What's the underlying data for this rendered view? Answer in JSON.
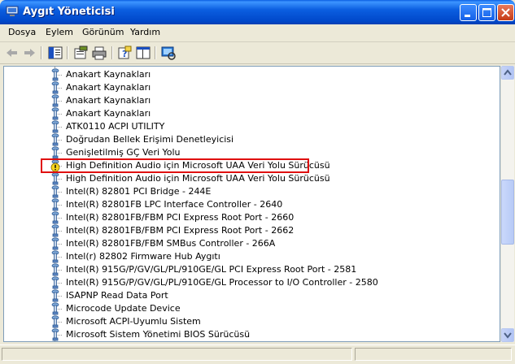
{
  "window": {
    "title": "Aygıt Yöneticisi",
    "accent": "#0047c9"
  },
  "menu": [
    "Dosya",
    "Eylem",
    "Görünüm",
    "Yardım"
  ],
  "toolbar": {
    "buttons": [
      "back-icon",
      "forward-icon",
      "show-hide-tree-icon",
      "properties-icon",
      "print-icon",
      "help-icon",
      "console-view-icon",
      "scan-hardware-icon"
    ]
  },
  "devices": [
    {
      "label": "Anakart Kaynakları",
      "status": "ok"
    },
    {
      "label": "Anakart Kaynakları",
      "status": "ok"
    },
    {
      "label": "Anakart Kaynakları",
      "status": "ok"
    },
    {
      "label": "Anakart Kaynakları",
      "status": "ok"
    },
    {
      "label": "ATK0110 ACPI UTILITY",
      "status": "ok"
    },
    {
      "label": "Doğrudan Bellek Erişimi Denetleyicisi",
      "status": "ok"
    },
    {
      "label": "Genişletilmiş GÇ Veri Yolu",
      "status": "ok"
    },
    {
      "label": "High Definition Audio için Microsoft  UAA Veri Yolu Sürücüsü",
      "status": "warning"
    },
    {
      "label": "High Definition Audio için Microsoft  UAA Veri Yolu Sürücüsü",
      "status": "ok"
    },
    {
      "label": "Intel(R) 82801 PCI Bridge - 244E",
      "status": "ok"
    },
    {
      "label": "Intel(R) 82801FB LPC Interface Controller - 2640",
      "status": "ok"
    },
    {
      "label": "Intel(R) 82801FB/FBM PCI Express Root Port - 2660",
      "status": "ok"
    },
    {
      "label": "Intel(R) 82801FB/FBM PCI Express Root Port - 2662",
      "status": "ok"
    },
    {
      "label": "Intel(R) 82801FB/FBM SMBus Controller - 266A",
      "status": "ok"
    },
    {
      "label": "Intel(r) 82802 Firmware Hub Aygıtı",
      "status": "ok"
    },
    {
      "label": "Intel(R) 915G/P/GV/GL/PL/910GE/GL PCI Express Root Port - 2581",
      "status": "ok"
    },
    {
      "label": "Intel(R) 915G/P/GV/GL/PL/910GE/GL Processor to I/O Controller - 2580",
      "status": "ok"
    },
    {
      "label": "ISAPNP Read Data Port",
      "status": "ok"
    },
    {
      "label": "Microcode Update Device",
      "status": "ok"
    },
    {
      "label": "Microsoft ACPI-Uyumlu Sistem",
      "status": "ok"
    },
    {
      "label": "Microsoft Sistem Yönetimi BIOS Sürücüsü",
      "status": "ok"
    }
  ],
  "highlight_color": "#e01010"
}
